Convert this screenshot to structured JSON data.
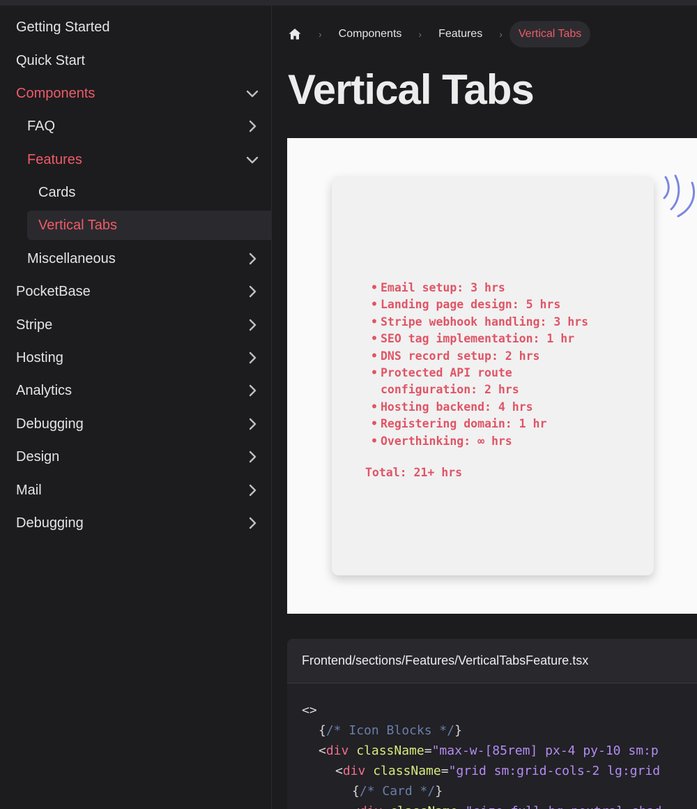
{
  "sidebar": {
    "items": [
      {
        "label": "Getting Started",
        "chevron": "none",
        "state": "normal"
      },
      {
        "label": "Quick Start",
        "chevron": "none",
        "state": "normal"
      },
      {
        "label": "Components",
        "chevron": "down",
        "state": "active"
      },
      {
        "label": "FAQ",
        "chevron": "right",
        "state": "normal"
      },
      {
        "label": "Features",
        "chevron": "down",
        "state": "active"
      },
      {
        "label": "Cards",
        "chevron": "none",
        "state": "normal"
      },
      {
        "label": "Vertical Tabs",
        "chevron": "none",
        "state": "selected"
      },
      {
        "label": "Miscellaneous",
        "chevron": "right",
        "state": "normal"
      },
      {
        "label": "PocketBase",
        "chevron": "right",
        "state": "normal"
      },
      {
        "label": "Stripe",
        "chevron": "right",
        "state": "normal"
      },
      {
        "label": "Hosting",
        "chevron": "right",
        "state": "normal"
      },
      {
        "label": "Analytics",
        "chevron": "right",
        "state": "normal"
      },
      {
        "label": "Debugging",
        "chevron": "right",
        "state": "normal"
      },
      {
        "label": "Design",
        "chevron": "right",
        "state": "normal"
      },
      {
        "label": "Mail",
        "chevron": "right",
        "state": "normal"
      },
      {
        "label": "Debugging",
        "chevron": "right",
        "state": "normal"
      }
    ]
  },
  "breadcrumb": {
    "home_icon": "home-icon",
    "items": [
      "Components",
      "Features",
      "Vertical Tabs"
    ]
  },
  "page": {
    "title": "Vertical Tabs"
  },
  "preview": {
    "list": [
      "Email setup: 3 hrs",
      "Landing page design: 5 hrs",
      "Stripe webhook handling: 3 hrs",
      "SEO tag implementation: 1 hr",
      "DNS record setup: 2 hrs",
      "Protected API route",
      "configuration: 2 hrs",
      "Hosting backend: 4 hrs",
      "Registering domain: 1 hr",
      "Overthinking: ∞ hrs"
    ],
    "total": "Total: 21+ hrs"
  },
  "code": {
    "filename": "Frontend/sections/Features/VerticalTabsFeature.tsx",
    "lines": [
      "<>",
      "{/* Icon Blocks */}",
      "<div className=\"max-w-[85rem] px-4 py-10 sm:p",
      "<div className=\"grid sm:grid-cols-2 lg:grid",
      "{/* Card */}",
      "<div className=\"size-full bg-neutral-shad"
    ]
  },
  "colors": {
    "accent": "#ef5b67",
    "background": "#1c1c1f",
    "preview_bg": "#fafafa",
    "card_text": "#e05566"
  }
}
